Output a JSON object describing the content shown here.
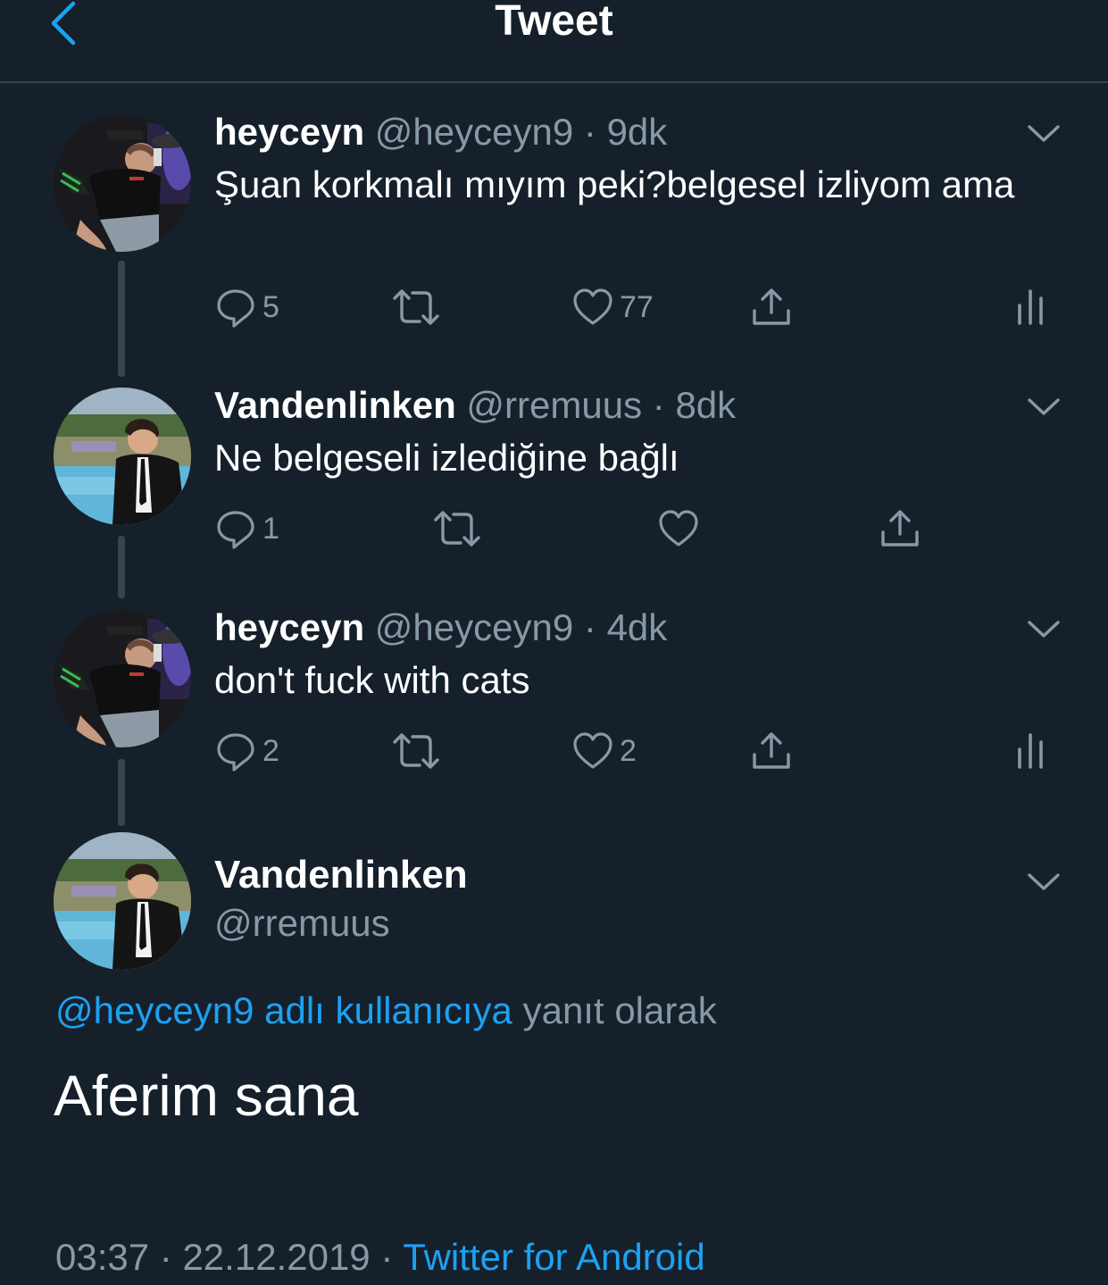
{
  "header": {
    "title": "Tweet"
  },
  "tweets": [
    {
      "name": "heyceyn",
      "handle": "@heyceyn9",
      "sep": "·",
      "time": "9dk",
      "text": "Şuan korkmalı mıyım peki?belgesel izliyom ama",
      "replies": "5",
      "likes": "77"
    },
    {
      "name": "Vandenlinken",
      "handle": "@rremuus",
      "sep": "·",
      "time": "8dk",
      "text": "Ne belgeseli izlediğine bağlı",
      "replies": "1",
      "likes": ""
    },
    {
      "name": "heyceyn",
      "handle": "@heyceyn9",
      "sep": "·",
      "time": "4dk",
      "text": "don't fuck with cats",
      "replies": "2",
      "likes": "2"
    }
  ],
  "main_tweet": {
    "name": "Vandenlinken",
    "handle": "@rremuus",
    "reply_to_link": "@heyceyn9 adlı kullanıcıya",
    "reply_to_suffix": " yanıt olarak",
    "text": "Aferim sana",
    "time": "03:37",
    "sep": "·",
    "date": "22.12.2019",
    "source": "Twitter for Android"
  },
  "colors": {
    "background": "#15202b",
    "accent": "#1da1f2",
    "muted": "#8899a6",
    "divider": "#38444d"
  },
  "icons": [
    "back-chevron-icon",
    "reply-icon",
    "retweet-icon",
    "like-icon",
    "share-icon",
    "analytics-icon",
    "caret-down-icon"
  ]
}
